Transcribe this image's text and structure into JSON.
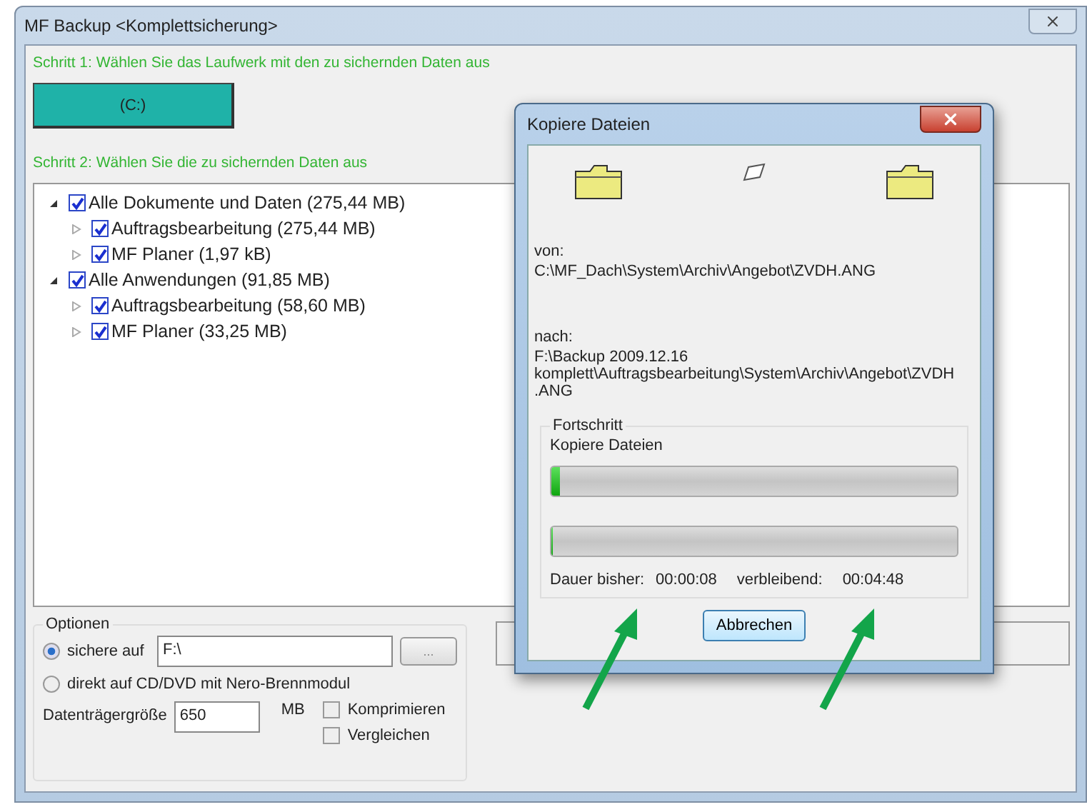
{
  "window": {
    "title": "MF Backup <Komplettsicherung>"
  },
  "step1": "Schritt 1: Wählen Sie das Laufwerk mit den zu sichernden Daten aus",
  "drives": [
    {
      "label": "(C:)",
      "selected": true
    }
  ],
  "step2": "Schritt 2: Wählen Sie die zu sichernden Daten aus",
  "tree": [
    {
      "label": "Alle Dokumente und Daten (275,44 MB)",
      "checked": true,
      "expanded": true,
      "children": [
        {
          "label": "Auftragsbearbeitung (275,44 MB)",
          "checked": true,
          "expanded": false
        },
        {
          "label": "MF Planer (1,97 kB)",
          "checked": true,
          "expanded": false
        }
      ]
    },
    {
      "label": "Alle Anwendungen (91,85 MB)",
      "checked": true,
      "expanded": true,
      "children": [
        {
          "label": "Auftragsbearbeitung (58,60 MB)",
          "checked": true,
          "expanded": false
        },
        {
          "label": "MF Planer (33,25 MB)",
          "checked": true,
          "expanded": false
        }
      ]
    }
  ],
  "options": {
    "title": "Optionen",
    "targets": [
      {
        "label": "sichere auf",
        "selected": true
      },
      {
        "label": "direkt auf CD/DVD mit Nero-Brennmodul",
        "selected": false
      }
    ],
    "path": "F:\\",
    "browse": "...",
    "size_label": "Datenträgergröße",
    "size": "650",
    "size_unit": "MB",
    "checks": [
      {
        "label": "Komprimieren",
        "checked": false
      },
      {
        "label": "Vergleichen",
        "checked": false
      }
    ]
  },
  "dialog": {
    "title": "Kopiere Dateien",
    "from_label": "von:",
    "from": "C:\\MF_Dach\\System\\Archiv\\Angebot\\ZVDH.ANG",
    "to_label": "nach:",
    "to": "F:\\Backup 2009.12.16 komplett\\Auftragsbearbeitung\\System\\Archiv\\Angebot\\ZVDH.ANG",
    "group": "Fortschritt",
    "progress_label": "Kopiere Dateien",
    "bars": [
      {
        "level": 0.02
      },
      {
        "level": 0
      }
    ],
    "elapsed_label": "Dauer bisher:",
    "elapsed": "00:00:08",
    "remaining_label": "verbleibend:",
    "remaining": "00:04:48",
    "cancel": "Abbrechen"
  }
}
